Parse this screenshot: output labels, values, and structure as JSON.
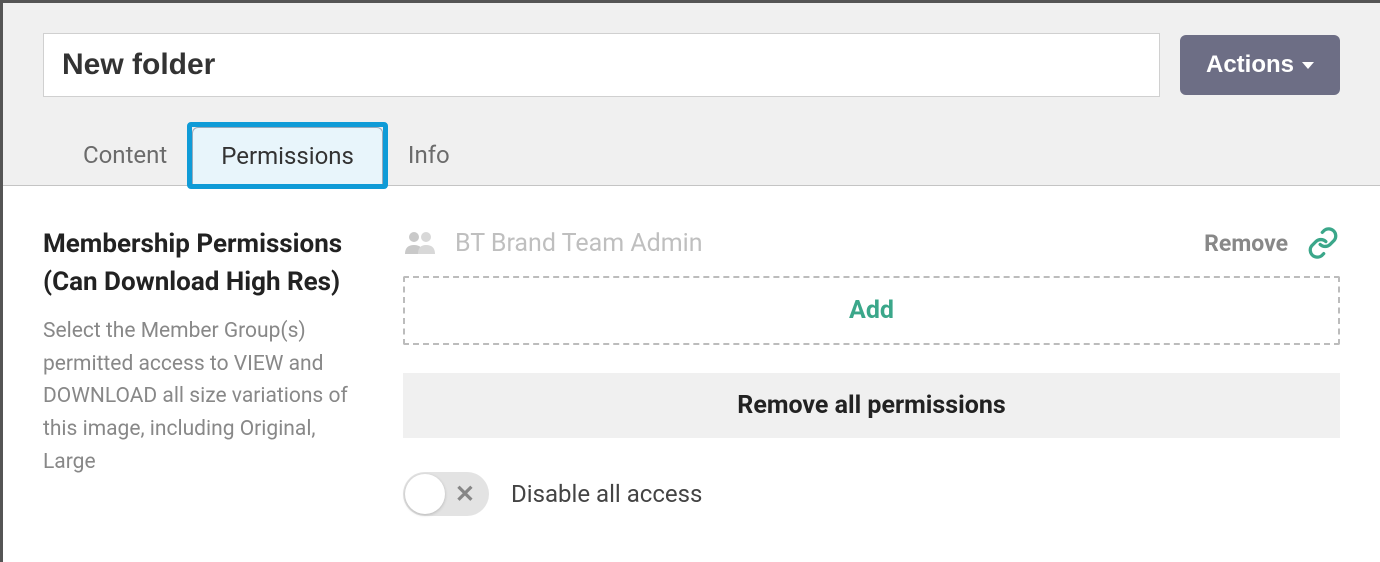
{
  "header": {
    "title_value": "New folder",
    "actions_label": "Actions"
  },
  "tabs": {
    "content": "Content",
    "permissions": "Permissions",
    "info": "Info"
  },
  "permissions": {
    "section_title": "Membership Permissions (Can Download High Res)",
    "section_desc": "Select the Member Group(s) permitted access to VIEW and DOWNLOAD all size variations of this image, including Original, Large",
    "group_name": "BT Brand Team Admin",
    "remove_label": "Remove",
    "add_label": "Add",
    "remove_all_label": "Remove all permissions",
    "disable_all_label": "Disable all access"
  },
  "colors": {
    "accent_green": "#3ba78a",
    "highlight_blue": "#0f9bd7",
    "button_bg": "#6d6e85"
  }
}
